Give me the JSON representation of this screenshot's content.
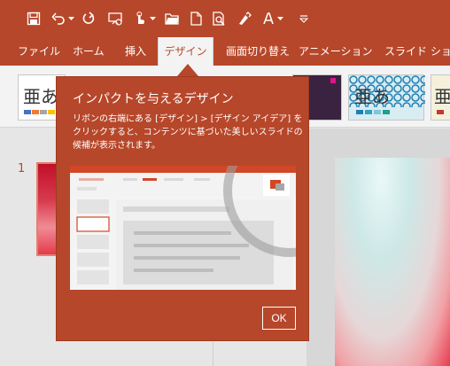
{
  "qat": {
    "icons": [
      "save-icon",
      "undo-icon",
      "undo-dropdown-icon",
      "redo-icon",
      "slideshow-from-start-icon",
      "touch-mode-icon",
      "open-folder-icon",
      "new-file-icon",
      "print-preview-icon",
      "spelling-icon",
      "font-color-icon",
      "font-color-dropdown-icon",
      "customize-qat-icon"
    ]
  },
  "tabs": [
    {
      "label": "ファイル"
    },
    {
      "label": "ホーム"
    },
    {
      "label": "挿入"
    },
    {
      "label": "デザイン"
    },
    {
      "label": "画面切り替え"
    },
    {
      "label": "アニメーション"
    },
    {
      "label": "スライド ショー"
    }
  ],
  "ribbon": {
    "themes": [
      {
        "glyph": "亜あ"
      },
      {
        "glyph": ""
      },
      {
        "glyph": "亜あ"
      },
      {
        "glyph": "亜"
      }
    ]
  },
  "slides": {
    "number": "1"
  },
  "callout": {
    "title": "インパクトを与えるデザイン",
    "body": "リボンの右端にある [デザイン] > [デザイン アイデア] をクリックすると、コンテンツに基づいた美しいスライドの候補が表示されます。",
    "ok_label": "OK"
  },
  "colors": {
    "accent": "#b7472a",
    "ribbon_bg": "#f3f3f3"
  }
}
